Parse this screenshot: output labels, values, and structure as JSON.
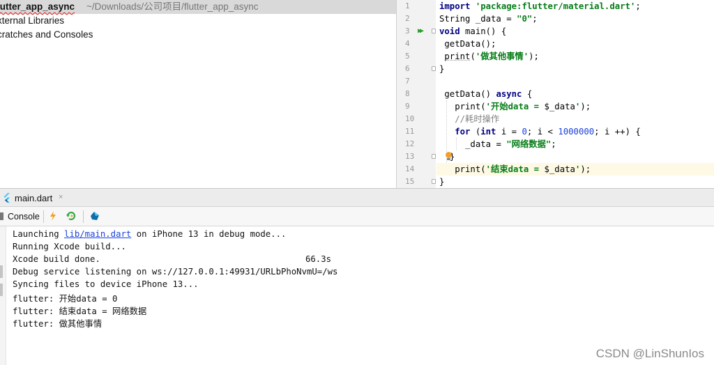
{
  "project_tree": {
    "project_name": "lutter_app_async",
    "project_path": "~/Downloads/公司项目/flutter_app_async",
    "items": [
      "xternal Libraries",
      "cratches and Consoles"
    ]
  },
  "editor": {
    "line_numbers": [
      "1",
      "2",
      "3",
      "4",
      "5",
      "6",
      "7",
      "8",
      "9",
      "10",
      "11",
      "12",
      "13",
      "14",
      "15"
    ],
    "code": {
      "l1": {
        "kw": "import",
        "str": "'package:flutter/material.dart'",
        "end": ";"
      },
      "l2": {
        "pre": "String _data = ",
        "str": "\"0\"",
        "end": ";"
      },
      "l3": {
        "kw": "void",
        "rest": " main() {"
      },
      "l4": {
        "text": " getData();"
      },
      "l5": {
        "fn": "print",
        "open": "(",
        "str": "'做其他事情'",
        "end": ");"
      },
      "l6": {
        "text": "}"
      },
      "l8": {
        "pre": " getData() ",
        "kw": "async",
        "end": " {"
      },
      "l9": {
        "fn": "print",
        "open": "(",
        "str": "'开始data = ",
        "var": "$_data",
        "strend": "'",
        "end": ");"
      },
      "l10": {
        "comment": "//耗时操作"
      },
      "l11": {
        "kw": "for",
        "a": " (",
        "kw2": "int",
        "b": " i = ",
        "n1": "0",
        "c": "; i < ",
        "n2": "1000000",
        "d": "; i ++) {"
      },
      "l12": {
        "pre": "_data = ",
        "str": "\"网络数据\"",
        "end": ";"
      },
      "l13": {
        "text": "}"
      },
      "l14": {
        "fn": "print",
        "open": "(",
        "str": "'结束data = ",
        "var": "$_data",
        "strend": "'",
        "end": ");"
      },
      "l15": {
        "text": "}"
      }
    }
  },
  "run_panel": {
    "tab_label": "main.dart",
    "close_glyph": "×",
    "console_label": "Console"
  },
  "console_output": {
    "launch_prefix": "Launching ",
    "launch_link": "lib/main.dart",
    "launch_suffix": " on iPhone 13 in debug mode...",
    "lines": [
      "Running Xcode build...",
      "Xcode build done.",
      "Debug service listening on ws://127.0.0.1:49931/URLbPhoNvmU=/ws",
      "Syncing files to device iPhone 13...",
      "flutter: 开始data = 0",
      "flutter: 结束data = 网络数据",
      "flutter: 做其他事情"
    ],
    "build_time": "66.3s"
  },
  "watermark": "CSDN @LinShunIos",
  "colors": {
    "keyword": "#000080",
    "string": "#067d17",
    "number": "#1a40d9",
    "comment": "#808080",
    "current_line": "#fdf9e4",
    "selection": "#d9d9d9"
  }
}
